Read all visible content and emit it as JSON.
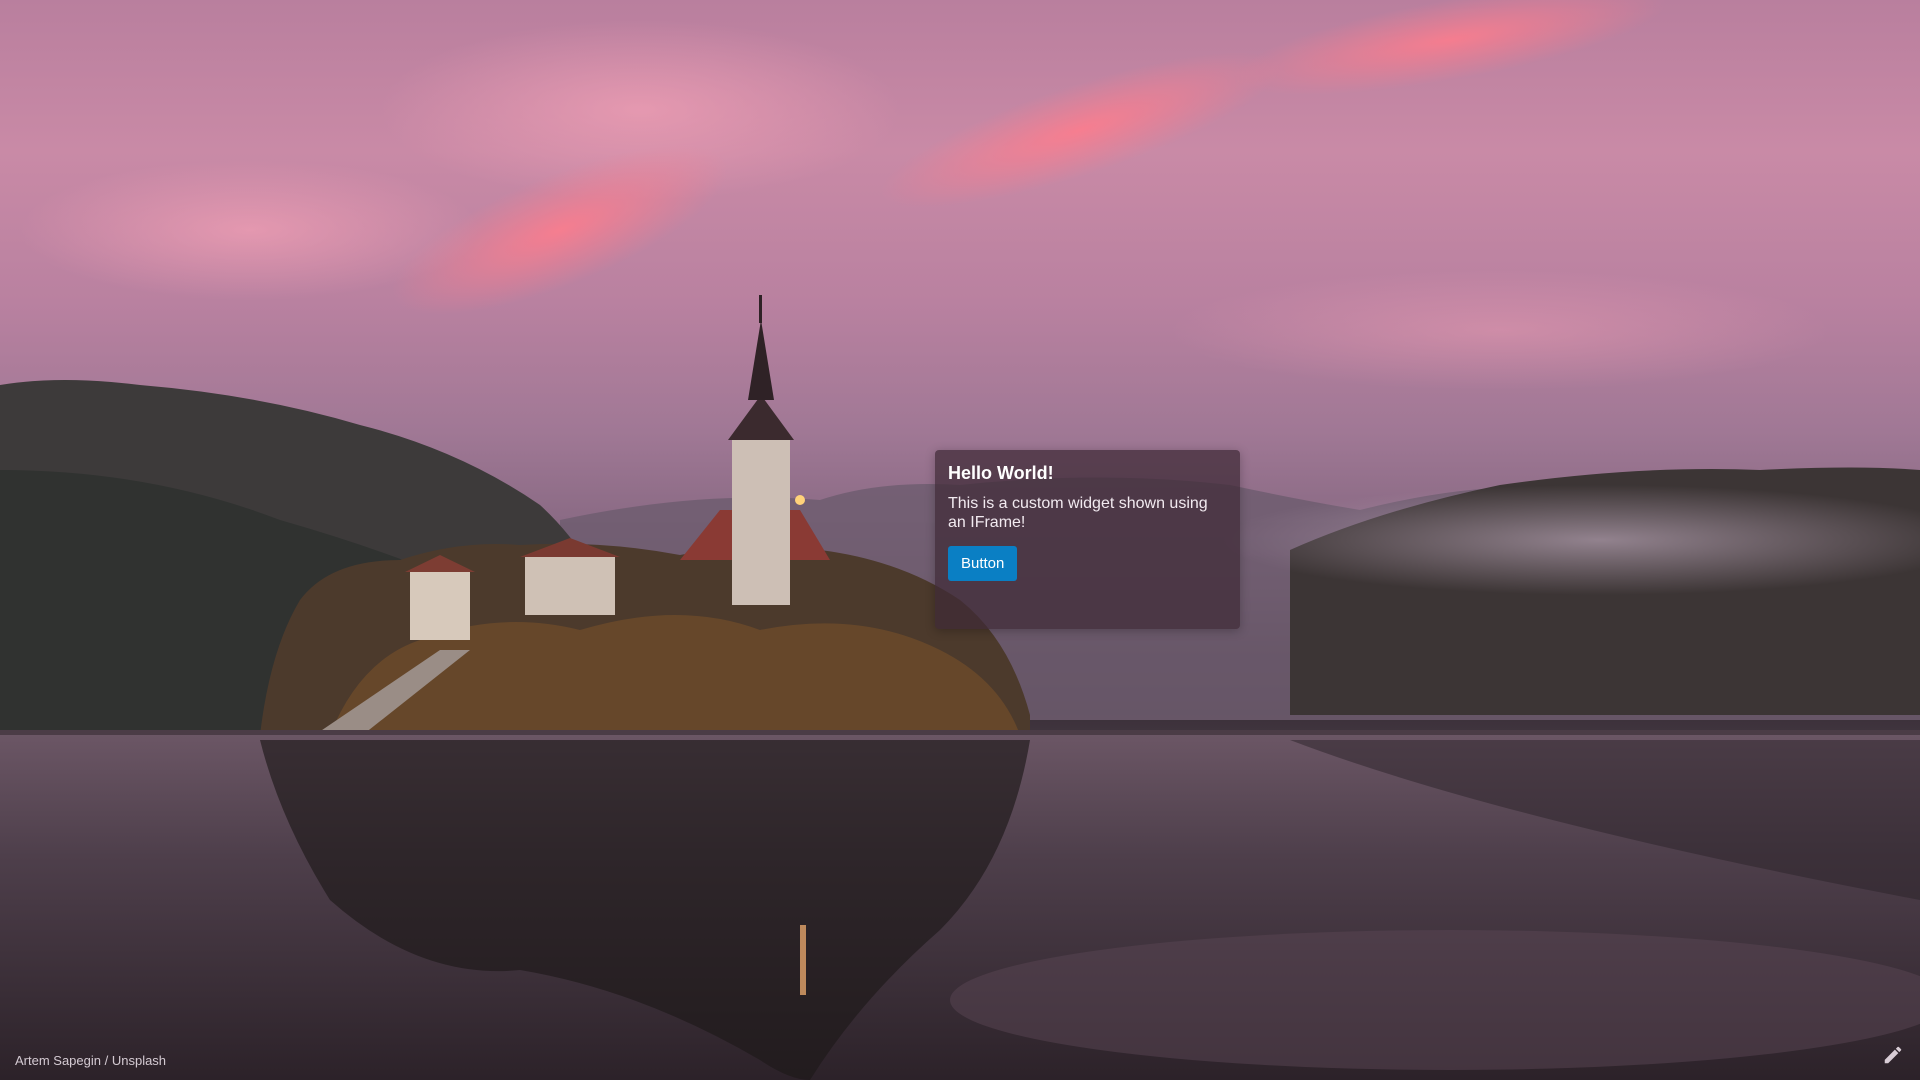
{
  "widget": {
    "title": "Hello World!",
    "text": "This is a custom widget shown using an IFrame!",
    "button_label": "Button"
  },
  "credit": {
    "author": "Artem Sapegin",
    "separator": " / ",
    "source": "Unsplash"
  },
  "edit": {
    "icon": "pencil-icon"
  },
  "colors": {
    "button_bg": "#0a7fc4",
    "widget_bg": "#3e2a36",
    "sky_pink": "#f27a8a"
  }
}
